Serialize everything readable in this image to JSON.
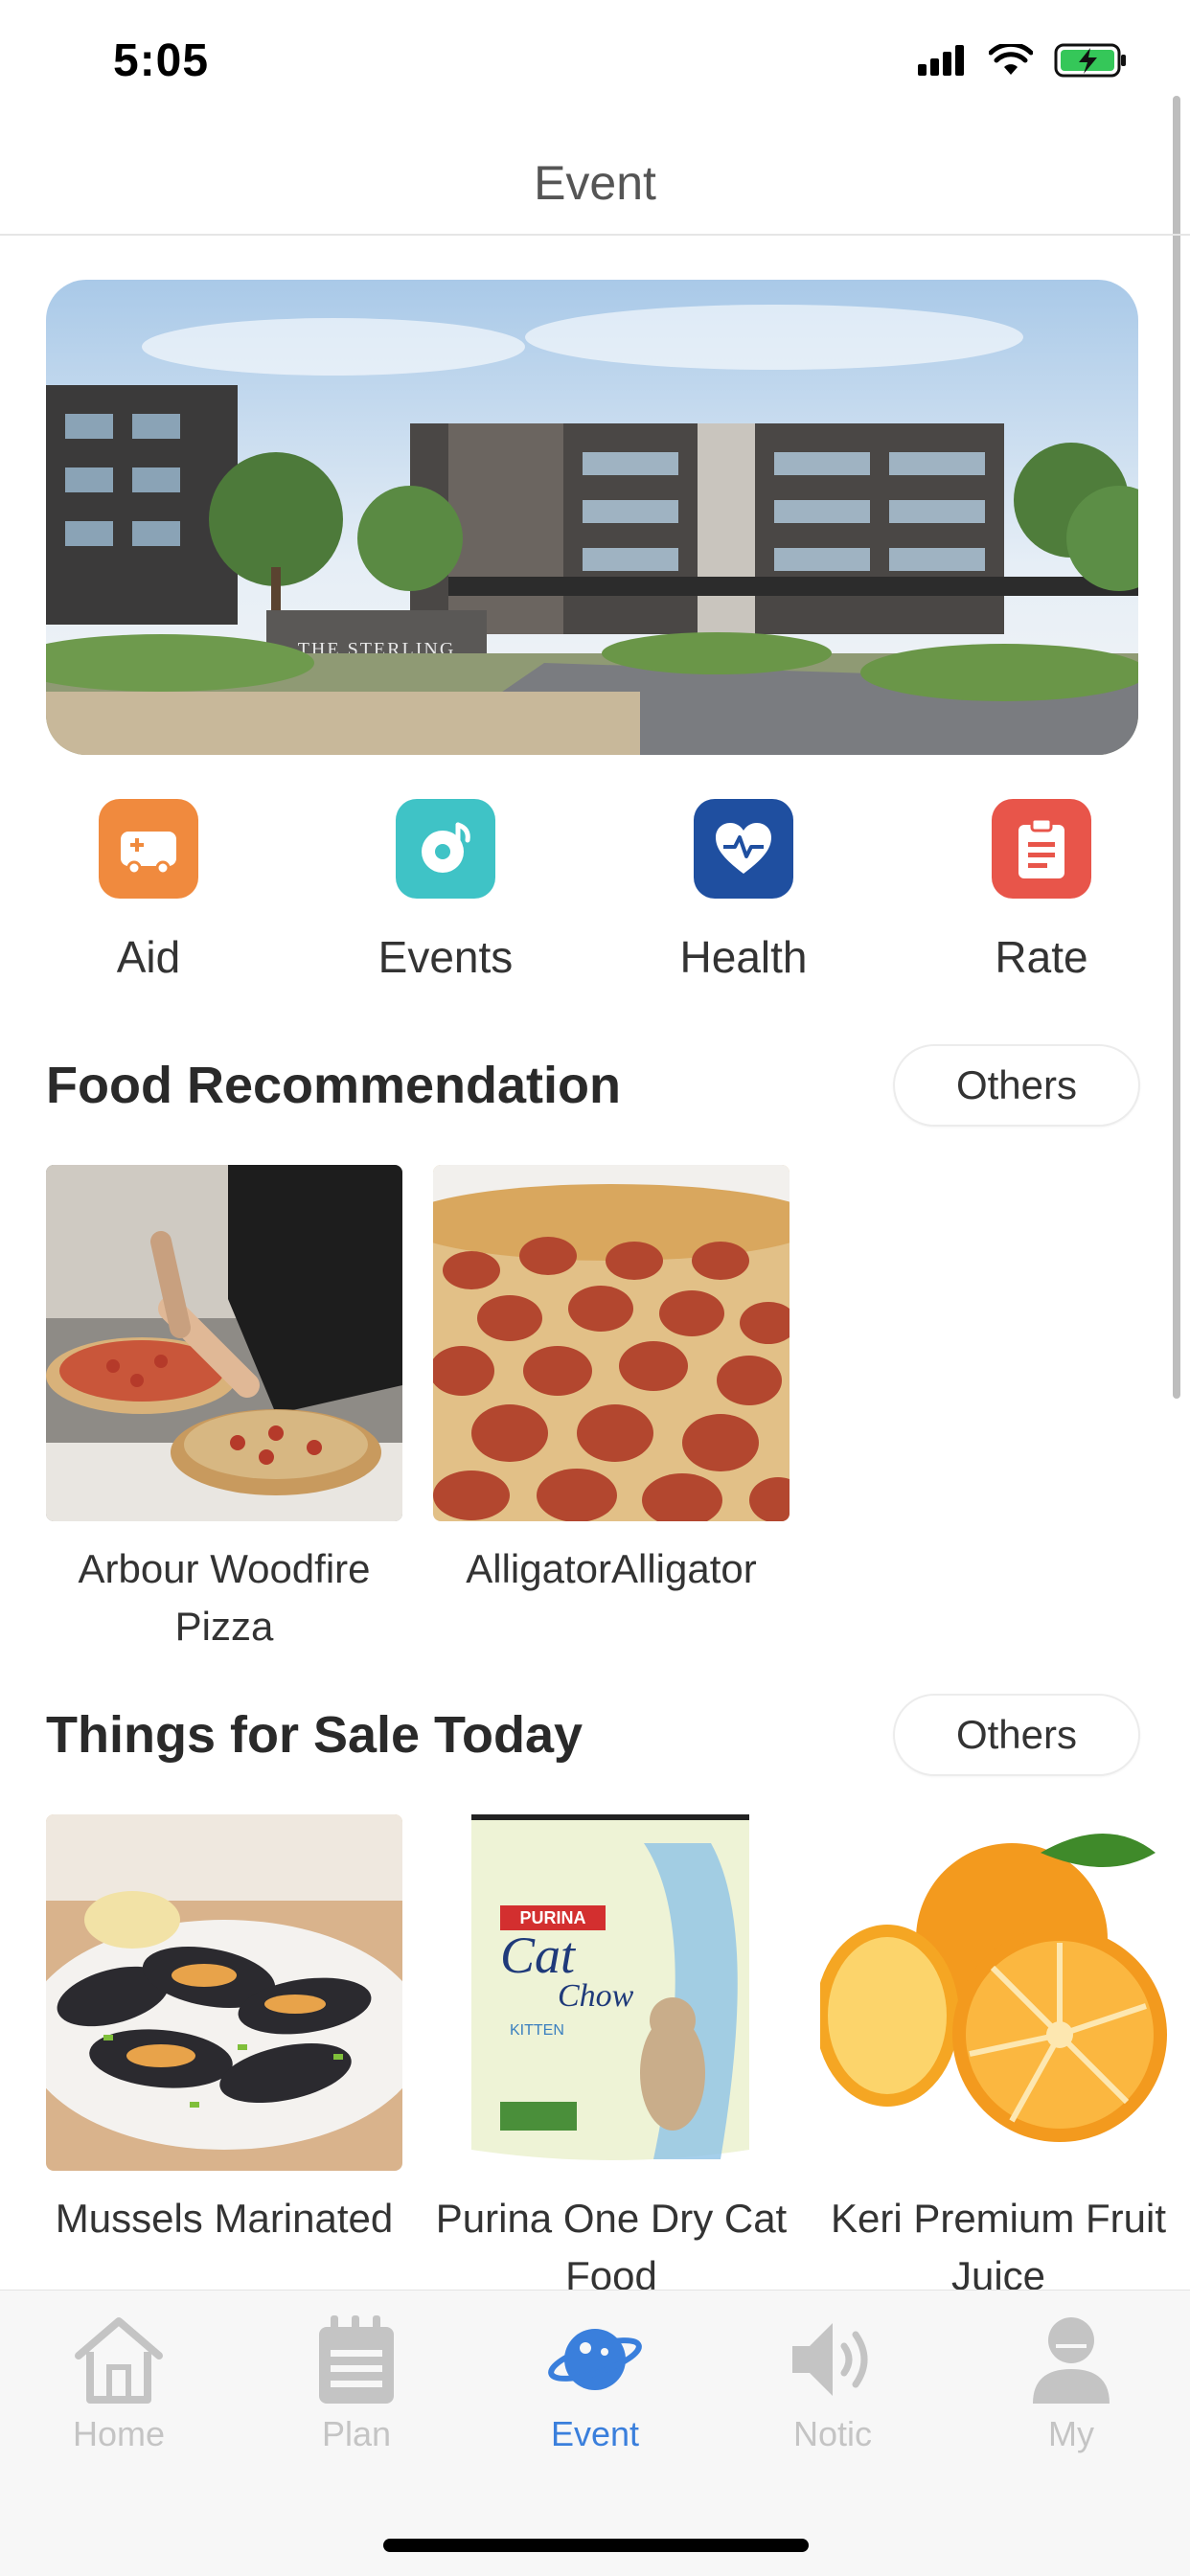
{
  "status_bar": {
    "time": "5:05"
  },
  "header": {
    "title": "Event"
  },
  "quick_actions": [
    {
      "label": "Aid",
      "icon": "first-aid-kit-icon",
      "color": "#F08A3E"
    },
    {
      "label": "Events",
      "icon": "music-disc-icon",
      "color": "#3FC3C6"
    },
    {
      "label": "Health",
      "icon": "heart-pulse-icon",
      "color": "#1F4FA0"
    },
    {
      "label": "Rate",
      "icon": "clipboard-icon",
      "color": "#E8554A"
    }
  ],
  "food": {
    "title": "Food Recommendation",
    "others_label": "Others",
    "items": [
      {
        "name": "Arbour Woodfire Pizza"
      },
      {
        "name": "AlligatorAlligator"
      }
    ]
  },
  "sale": {
    "title": "Things for Sale Today",
    "others_label": "Others",
    "items": [
      {
        "name": "Mussels Marinated"
      },
      {
        "name": "Purina One Dry Cat Food"
      },
      {
        "name": "Keri Premium Fruit Juice"
      }
    ]
  },
  "tab_bar": {
    "tabs": [
      {
        "label": "Home",
        "icon": "house-icon"
      },
      {
        "label": "Plan",
        "icon": "notepad-icon"
      },
      {
        "label": "Event",
        "icon": "planet-icon",
        "active": true
      },
      {
        "label": "Notic",
        "icon": "speaker-icon"
      },
      {
        "label": "My",
        "icon": "user-icon"
      }
    ]
  },
  "colors": {
    "accent": "#3A7FDC",
    "inactive_tab": "#C4C4C4"
  }
}
